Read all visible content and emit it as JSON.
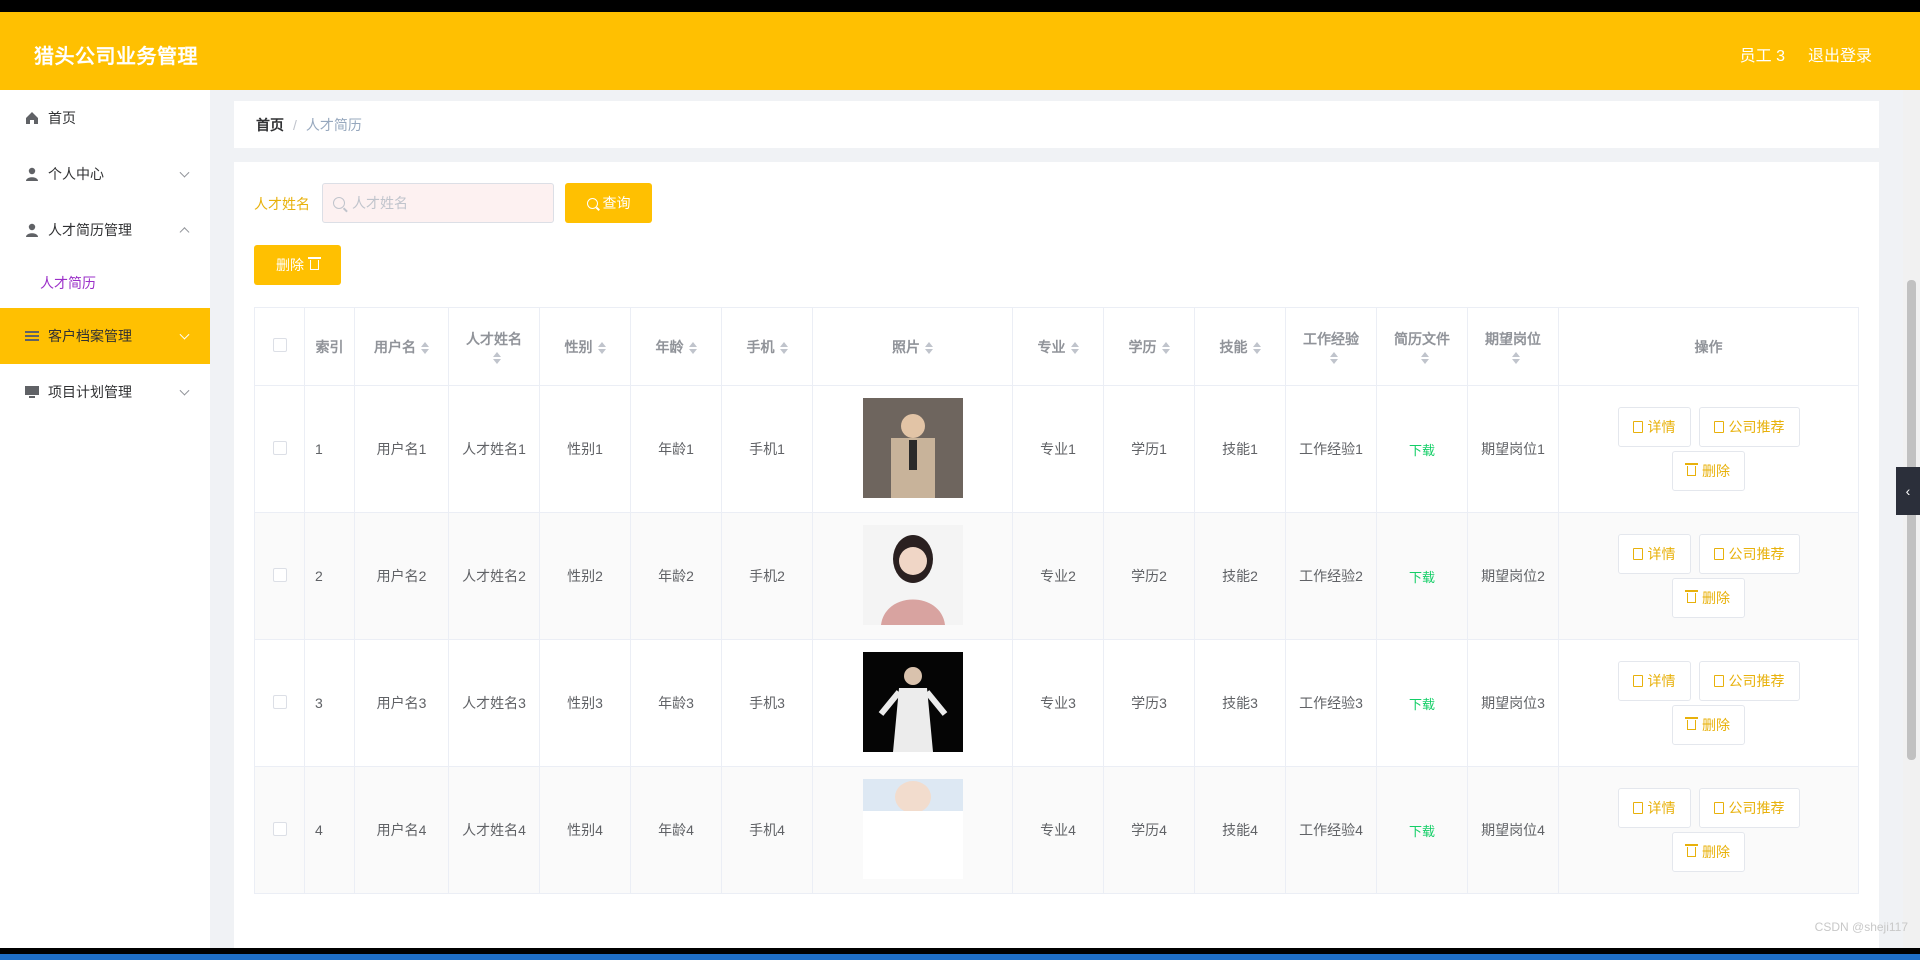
{
  "header": {
    "title": "猎头公司业务管理",
    "user": "员工 3",
    "logout": "退出登录"
  },
  "sidebar": {
    "items": [
      {
        "label": "首页",
        "icon": "home-icon"
      },
      {
        "label": "个人中心",
        "icon": "user-icon"
      },
      {
        "label": "人才简历管理",
        "icon": "user-icon"
      },
      {
        "label": "客户档案管理",
        "icon": "list-icon"
      },
      {
        "label": "项目计划管理",
        "icon": "monitor-icon"
      }
    ],
    "sub_items": [
      {
        "label": "人才简历"
      }
    ]
  },
  "breadcrumb": {
    "home": "首页",
    "current": "人才简历"
  },
  "search": {
    "label": "人才姓名",
    "placeholder": "人才姓名",
    "button": "查询"
  },
  "toolbar": {
    "delete_label": "删除"
  },
  "table": {
    "headers": [
      "索引",
      "用户名",
      "人才姓名",
      "性别",
      "年龄",
      "手机",
      "照片",
      "专业",
      "学历",
      "技能",
      "工作经验",
      "简历文件",
      "期望岗位",
      "操作"
    ],
    "rows": [
      {
        "idx": "1",
        "user": "用户名1",
        "name": "人才姓名1",
        "gender": "性别1",
        "age": "年龄1",
        "phone": "手机1",
        "major": "专业1",
        "edu": "学历1",
        "skill": "技能1",
        "exp": "工作经验1",
        "file": "下载",
        "post": "期望岗位1"
      },
      {
        "idx": "2",
        "user": "用户名2",
        "name": "人才姓名2",
        "gender": "性别2",
        "age": "年龄2",
        "phone": "手机2",
        "major": "专业2",
        "edu": "学历2",
        "skill": "技能2",
        "exp": "工作经验2",
        "file": "下载",
        "post": "期望岗位2"
      },
      {
        "idx": "3",
        "user": "用户名3",
        "name": "人才姓名3",
        "gender": "性别3",
        "age": "年龄3",
        "phone": "手机3",
        "major": "专业3",
        "edu": "学历3",
        "skill": "技能3",
        "exp": "工作经验3",
        "file": "下载",
        "post": "期望岗位3"
      },
      {
        "idx": "4",
        "user": "用户名4",
        "name": "人才姓名4",
        "gender": "性别4",
        "age": "年龄4",
        "phone": "手机4",
        "major": "专业4",
        "edu": "学历4",
        "skill": "技能4",
        "exp": "工作经验4",
        "file": "下载",
        "post": "期望岗位4"
      }
    ],
    "actions": {
      "detail": "详情",
      "recommend": "公司推荐",
      "delete": "删除"
    }
  },
  "watermark": "CSDN @sheji117",
  "colors": {
    "accent": "#ffc001",
    "download": "#13ce66",
    "active_sub": "#9b30c8"
  }
}
